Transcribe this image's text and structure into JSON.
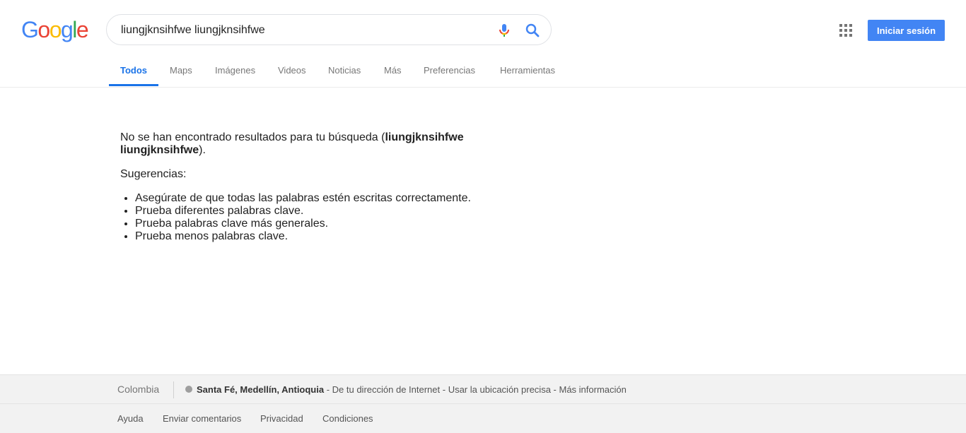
{
  "logo": {
    "letters": [
      "G",
      "o",
      "o",
      "g",
      "l",
      "e"
    ],
    "colors": [
      "#4285f4",
      "#ea4335",
      "#fbbc05",
      "#4285f4",
      "#34a853",
      "#ea4335"
    ]
  },
  "search": {
    "query": "liungjknsihfwe liungjknsihfwe"
  },
  "header": {
    "signin_label": "Iniciar sesión"
  },
  "tabs": [
    {
      "label": "Todos",
      "active": true
    },
    {
      "label": "Maps"
    },
    {
      "label": "Imágenes"
    },
    {
      "label": "Videos"
    },
    {
      "label": "Noticias"
    },
    {
      "label": "Más"
    },
    {
      "label": "Preferencias"
    },
    {
      "label": "Herramientas"
    }
  ],
  "results": {
    "no_results_prefix": "No se han encontrado resultados para tu búsqueda (",
    "no_results_query": "liungjknsihfwe liungjknsihfwe",
    "no_results_suffix": ").",
    "suggestions_title": "Sugerencias:",
    "suggestions": [
      "Asegúrate de que todas las palabras estén escritas correctamente.",
      "Prueba diferentes palabras clave.",
      "Prueba palabras clave más generales.",
      "Prueba menos palabras clave."
    ]
  },
  "footer": {
    "country": "Colombia",
    "location": "Santa Fé, Medellín, Antioquia",
    "location_source": " - De tu dirección de Internet - ",
    "precise_link": "Usar la ubicación precisa",
    "dash": " - ",
    "more_info": "Más información",
    "links": [
      "Ayuda",
      "Enviar comentarios",
      "Privacidad",
      "Condiciones"
    ]
  },
  "colors": {
    "accent": "#1a73e8",
    "signin_bg": "#4285f4"
  }
}
